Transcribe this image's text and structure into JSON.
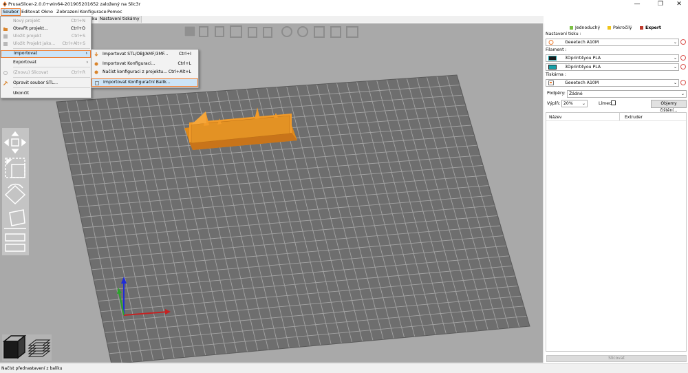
{
  "window": {
    "title": "PrusaSlicer-2.0.0+win64-201905201652 založený na Slic3r",
    "controls": {
      "minimize": "—",
      "maximize": "❐",
      "close": "✕"
    }
  },
  "menubar": {
    "items": [
      {
        "name": "menu-soubor",
        "label": "Soubor"
      },
      {
        "name": "menu-editovat",
        "label": "Editovat"
      },
      {
        "name": "menu-okno",
        "label": "Okno"
      },
      {
        "name": "menu-zobrazeni",
        "label": "Zobrazení"
      },
      {
        "name": "menu-konfigurace",
        "label": "Konfigurace"
      },
      {
        "name": "menu-pomoc",
        "label": "Pomoc"
      }
    ]
  },
  "tabs": {
    "hidden_tab_fragment": "ku",
    "printer_settings": "Nastavení tiskárny"
  },
  "file_menu": {
    "items": [
      {
        "name": "new-project",
        "label": "Nový projekt",
        "shortcut": "Ctrl+N",
        "disabled": true,
        "icon": ""
      },
      {
        "name": "open-project",
        "label": "Otevřít projekt...",
        "shortcut": "Ctrl+O",
        "disabled": false,
        "icon": "folder-icon"
      },
      {
        "name": "save-project",
        "label": "Uložit projekt",
        "shortcut": "Ctrl+S",
        "disabled": true,
        "icon": "save-icon"
      },
      {
        "name": "save-project-as",
        "label": "Uložit Projekt jako...",
        "shortcut": "Ctrl+Alt+S",
        "disabled": true,
        "icon": "save-icon"
      },
      {
        "name": "import",
        "label": "Importovat",
        "shortcut": "",
        "disabled": false,
        "submenu": true,
        "highlighted": true,
        "icon": ""
      },
      {
        "name": "export",
        "label": "Exportovat",
        "shortcut": "",
        "disabled": false,
        "submenu": true,
        "icon": ""
      },
      {
        "name": "reslice",
        "label": "(Znovu) Slicovat",
        "shortcut": "Ctrl+R",
        "disabled": true,
        "icon": "slice-icon"
      },
      {
        "name": "repair-stl",
        "label": "Opravit soubor STL...",
        "shortcut": "",
        "disabled": false,
        "icon": "wrench-icon"
      },
      {
        "name": "quit",
        "label": "Ukončit",
        "shortcut": "",
        "disabled": false,
        "icon": ""
      }
    ]
  },
  "import_submenu": {
    "items": [
      {
        "name": "import-stl",
        "label": "Importovat STL/OBJ/AMF/3MF...",
        "shortcut": "Ctrl+I",
        "icon": "import-icon"
      },
      {
        "name": "import-config",
        "label": "Importovat Konfiguraci...",
        "shortcut": "Ctrl+L",
        "icon": "config-icon"
      },
      {
        "name": "load-config-from-project",
        "label": "Načíst konfiguraci z projektu...",
        "shortcut": "Ctrl+Alt+L",
        "icon": "config-icon"
      },
      {
        "name": "import-config-bundle",
        "label": "Importovat Konfigurační Balík...",
        "shortcut": "",
        "icon": "bundle-icon",
        "highlighted": true
      }
    ]
  },
  "sidebar": {
    "modes": [
      {
        "name": "mode-simple",
        "label": "Jednoduchý",
        "color": "#7ac143"
      },
      {
        "name": "mode-advanced",
        "label": "Pokročilý",
        "color": "#f0c419"
      },
      {
        "name": "mode-expert",
        "label": "Expert",
        "color": "#c0392b"
      }
    ],
    "print_settings_label": "Nastavení tisku :",
    "print_settings_value": "Geeetech A10M",
    "filament_label": "Filament :",
    "filaments": [
      {
        "value": "3Dprint4you PLA",
        "color": "#1a1a1a"
      },
      {
        "value": "3Dprint4you PLA",
        "color": "#17a0a8"
      }
    ],
    "printer_label": "Tiskárna :",
    "printer_value": "Geeetech A10M",
    "supports_label": "Podpěry:",
    "supports_value": "Žádné",
    "infill_label": "Výplň:",
    "infill_value": "20%",
    "brim_label": "Límec:",
    "cleaning_button": "Objemy čištění...",
    "table_headers": {
      "name": "Název",
      "extruder": "Extruder"
    },
    "slice_button": "Slicovat"
  },
  "statusbar": {
    "text": "Načíst přednastavení z balíku"
  },
  "colors": {
    "accent": "#ed7d31",
    "highlight": "#cce4f7",
    "bed": "#6e6e6e",
    "object": "#f29b29",
    "viewport": "#a9a9a9"
  },
  "viewport_toolbar_icons": [
    "add-icon",
    "delete-icon",
    "delete-all-icon",
    "arrange-icon",
    "copy-icon",
    "paste-icon",
    "add-instance-icon",
    "remove-instance-icon",
    "split-objects-icon",
    "split-parts-icon",
    "layers-editing-icon"
  ],
  "gizmo_icons": [
    "move-icon",
    "scale-icon",
    "rotate-icon",
    "place-on-face-icon",
    "cut-icon"
  ],
  "view_icons": [
    "3d-view-icon",
    "preview-icon"
  ]
}
